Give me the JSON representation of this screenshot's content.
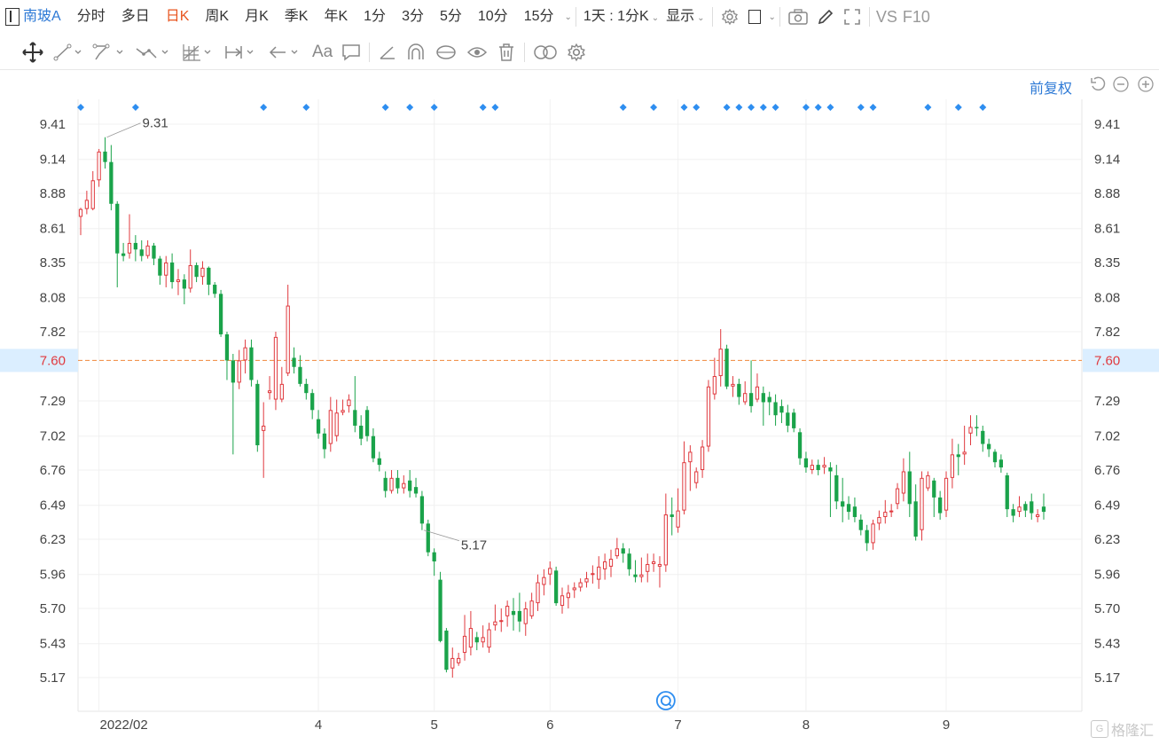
{
  "toolbar": {
    "stock_name": "南玻A",
    "periods": [
      "分时",
      "多日",
      "日K",
      "周K",
      "月K",
      "季K",
      "年K",
      "1分",
      "3分",
      "5分",
      "10分",
      "15分"
    ],
    "active_period": "日K",
    "interval_label": "1天 : 1分K",
    "display_label": "显示",
    "vs_label": "VS",
    "f10_label": "F10"
  },
  "drawing_tools": [
    "move-icon",
    "line-icon",
    "polyline-icon",
    "wave-icon",
    "grid-tool-icon",
    "measure-icon",
    "arrow-icon",
    "text-icon",
    "comment-icon",
    "angle-icon",
    "arch-icon",
    "cycle-icon",
    "eye-icon",
    "trash-icon",
    "link-icon",
    "settings-icon"
  ],
  "text_tool_label": "Aa",
  "adjust_label": "前复权",
  "watermark": "格隆汇",
  "colors": {
    "up": "#e0393e",
    "down": "#1aa34a",
    "accent": "#2e7ad6",
    "active": "#e8541e",
    "ref_line": "#f0883a"
  },
  "chart_data": {
    "type": "candlestick",
    "y_ticks": [
      "9.41",
      "9.14",
      "8.88",
      "8.61",
      "8.35",
      "8.08",
      "7.82",
      "7.29",
      "7.02",
      "6.76",
      "6.49",
      "6.23",
      "5.96",
      "5.70",
      "5.43",
      "5.17"
    ],
    "ylim": [
      5.06,
      9.58
    ],
    "x_tick_labels": [
      {
        "label": "2022/02",
        "index": 3
      },
      {
        "label": "4",
        "index": 39
      },
      {
        "label": "5",
        "index": 58
      },
      {
        "label": "6",
        "index": 77
      },
      {
        "label": "7",
        "index": 98
      },
      {
        "label": "8",
        "index": 119
      },
      {
        "label": "9",
        "index": 142
      }
    ],
    "current_price_label": "7.60",
    "current_price": 7.6,
    "high_label": "9.31",
    "high_index": 4,
    "low_label": "5.17",
    "low_index": 56,
    "event_marker_indices": [
      0,
      9,
      30,
      37,
      50,
      54,
      58,
      66,
      68,
      89,
      94,
      99,
      101,
      106,
      108,
      110,
      112,
      114,
      119,
      121,
      123,
      128,
      130,
      139,
      144,
      148
    ],
    "candles": [
      [
        8.7,
        8.76,
        8.56,
        8.77
      ],
      [
        8.76,
        8.83,
        8.72,
        8.9
      ],
      [
        8.76,
        8.98,
        8.75,
        9.05
      ],
      [
        8.98,
        9.2,
        8.93,
        9.22
      ],
      [
        9.2,
        9.12,
        9.07,
        9.31
      ],
      [
        9.12,
        8.8,
        8.75,
        9.25
      ],
      [
        8.8,
        8.42,
        8.16,
        8.82
      ],
      [
        8.42,
        8.4,
        8.36,
        8.5
      ],
      [
        8.42,
        8.5,
        8.38,
        8.72
      ],
      [
        8.5,
        8.45,
        8.36,
        8.56
      ],
      [
        8.45,
        8.4,
        8.36,
        8.52
      ],
      [
        8.4,
        8.48,
        8.38,
        8.52
      ],
      [
        8.48,
        8.38,
        8.33,
        8.5
      ],
      [
        8.38,
        8.25,
        8.18,
        8.4
      ],
      [
        8.25,
        8.35,
        8.16,
        8.4
      ],
      [
        8.35,
        8.2,
        8.15,
        8.42
      ],
      [
        8.2,
        8.22,
        8.1,
        8.3
      ],
      [
        8.22,
        8.15,
        8.03,
        8.26
      ],
      [
        8.15,
        8.33,
        8.12,
        8.45
      ],
      [
        8.33,
        8.24,
        8.2,
        8.35
      ],
      [
        8.24,
        8.31,
        8.18,
        8.36
      ],
      [
        8.31,
        8.18,
        8.1,
        8.32
      ],
      [
        8.18,
        8.11,
        8.08,
        8.2
      ],
      [
        8.11,
        7.8,
        7.78,
        8.14
      ],
      [
        7.8,
        7.6,
        7.45,
        7.82
      ],
      [
        7.6,
        7.43,
        6.88,
        7.65
      ],
      [
        7.43,
        7.6,
        7.38,
        7.68
      ],
      [
        7.6,
        7.7,
        7.5,
        7.76
      ],
      [
        7.7,
        7.45,
        7.4,
        7.76
      ],
      [
        7.42,
        6.95,
        6.9,
        7.45
      ],
      [
        7.06,
        7.1,
        6.7,
        7.28
      ],
      [
        7.35,
        7.37,
        7.3,
        7.48
      ],
      [
        7.3,
        7.78,
        7.22,
        7.82
      ],
      [
        7.3,
        7.42,
        7.28,
        7.55
      ],
      [
        7.5,
        8.02,
        7.48,
        8.18
      ],
      [
        7.62,
        7.55,
        7.5,
        7.7
      ],
      [
        7.55,
        7.42,
        7.4,
        7.64
      ],
      [
        7.42,
        7.35,
        7.3,
        7.46
      ],
      [
        7.35,
        7.22,
        7.15,
        7.38
      ],
      [
        7.15,
        7.04,
        7.0,
        7.22
      ],
      [
        7.04,
        6.92,
        6.85,
        7.08
      ],
      [
        6.96,
        7.22,
        6.9,
        7.32
      ],
      [
        7.02,
        7.2,
        6.98,
        7.3
      ],
      [
        7.2,
        7.22,
        7.18,
        7.3
      ],
      [
        7.25,
        7.3,
        7.2,
        7.34
      ],
      [
        7.22,
        7.1,
        7.05,
        7.48
      ],
      [
        7.1,
        7.0,
        6.95,
        7.18
      ],
      [
        7.22,
        7.02,
        6.98,
        7.25
      ],
      [
        7.02,
        6.85,
        6.82,
        7.08
      ],
      [
        6.85,
        6.8,
        6.75,
        6.9
      ],
      [
        6.7,
        6.6,
        6.55,
        6.75
      ],
      [
        6.6,
        6.7,
        6.58,
        6.76
      ],
      [
        6.7,
        6.62,
        6.58,
        6.76
      ],
      [
        6.62,
        6.66,
        6.58,
        6.72
      ],
      [
        6.68,
        6.6,
        6.55,
        6.76
      ],
      [
        6.63,
        6.58,
        6.55,
        6.7
      ],
      [
        6.56,
        6.35,
        6.3,
        6.6
      ],
      [
        6.35,
        6.13,
        6.1,
        6.38
      ],
      [
        6.13,
        6.06,
        5.95,
        6.16
      ],
      [
        5.92,
        5.45,
        5.44,
        5.98
      ],
      [
        5.53,
        5.23,
        5.21,
        5.55
      ],
      [
        5.24,
        5.32,
        5.17,
        5.4
      ],
      [
        5.28,
        5.32,
        5.26,
        5.36
      ],
      [
        5.36,
        5.49,
        5.3,
        5.65
      ],
      [
        5.4,
        5.55,
        5.34,
        5.68
      ],
      [
        5.48,
        5.44,
        5.38,
        5.52
      ],
      [
        5.44,
        5.48,
        5.4,
        5.57
      ],
      [
        5.4,
        5.54,
        5.36,
        5.59
      ],
      [
        5.57,
        5.6,
        5.53,
        5.73
      ],
      [
        5.6,
        5.61,
        5.52,
        5.7
      ],
      [
        5.64,
        5.72,
        5.56,
        5.76
      ],
      [
        5.68,
        5.65,
        5.53,
        5.78
      ],
      [
        5.68,
        5.6,
        5.52,
        5.82
      ],
      [
        5.58,
        5.7,
        5.49,
        5.75
      ],
      [
        5.64,
        5.76,
        5.62,
        5.82
      ],
      [
        5.74,
        5.9,
        5.68,
        5.96
      ],
      [
        5.88,
        5.94,
        5.8,
        6.0
      ],
      [
        5.96,
        6.01,
        5.88,
        6.06
      ],
      [
        5.99,
        5.74,
        5.72,
        6.02
      ],
      [
        5.72,
        5.8,
        5.66,
        5.86
      ],
      [
        5.78,
        5.82,
        5.7,
        5.88
      ],
      [
        5.84,
        5.86,
        5.78,
        5.9
      ],
      [
        5.86,
        5.9,
        5.83,
        5.93
      ],
      [
        5.9,
        5.93,
        5.86,
        5.98
      ],
      [
        5.96,
        5.97,
        5.89,
        6.03
      ],
      [
        5.92,
        6.02,
        5.85,
        6.1
      ],
      [
        6.0,
        6.06,
        5.92,
        6.12
      ],
      [
        6.02,
        6.08,
        5.94,
        6.15
      ],
      [
        6.1,
        6.16,
        6.08,
        6.24
      ],
      [
        6.16,
        6.12,
        6.05,
        6.2
      ],
      [
        6.12,
        6.0,
        5.95,
        6.16
      ],
      [
        5.96,
        5.94,
        5.9,
        6.07
      ],
      [
        5.94,
        5.96,
        5.9,
        6.09
      ],
      [
        5.98,
        6.04,
        5.9,
        6.12
      ],
      [
        6.04,
        6.06,
        5.98,
        6.12
      ],
      [
        6.02,
        6.04,
        5.86,
        6.1
      ],
      [
        6.03,
        6.42,
        5.98,
        6.58
      ],
      [
        6.42,
        6.4,
        6.26,
        6.55
      ],
      [
        6.32,
        6.45,
        6.28,
        6.62
      ],
      [
        6.45,
        6.82,
        6.42,
        6.98
      ],
      [
        6.82,
        6.9,
        6.6,
        6.95
      ],
      [
        6.66,
        6.75,
        6.62,
        6.78
      ],
      [
        6.76,
        6.94,
        6.7,
        6.99
      ],
      [
        6.94,
        7.4,
        6.9,
        7.45
      ],
      [
        7.34,
        7.48,
        7.3,
        7.62
      ],
      [
        7.48,
        7.69,
        7.4,
        7.84
      ],
      [
        7.69,
        7.4,
        7.38,
        7.72
      ],
      [
        7.4,
        7.42,
        7.32,
        7.48
      ],
      [
        7.42,
        7.32,
        7.26,
        7.46
      ],
      [
        7.28,
        7.35,
        7.26,
        7.44
      ],
      [
        7.35,
        7.25,
        7.2,
        7.6
      ],
      [
        7.3,
        7.4,
        7.28,
        7.5
      ],
      [
        7.35,
        7.28,
        7.1,
        7.4
      ],
      [
        7.32,
        7.28,
        7.18,
        7.36
      ],
      [
        7.28,
        7.18,
        7.1,
        7.34
      ],
      [
        7.25,
        7.2,
        7.12,
        7.3
      ],
      [
        7.2,
        7.1,
        7.05,
        7.26
      ],
      [
        7.2,
        7.08,
        7.05,
        7.23
      ],
      [
        7.05,
        6.85,
        6.8,
        7.08
      ],
      [
        6.85,
        6.78,
        6.74,
        6.9
      ],
      [
        6.76,
        6.8,
        6.73,
        6.84
      ],
      [
        6.8,
        6.76,
        6.72,
        6.84
      ],
      [
        6.78,
        6.8,
        6.73,
        6.86
      ],
      [
        6.78,
        6.75,
        6.4,
        6.82
      ],
      [
        6.72,
        6.52,
        6.46,
        6.8
      ],
      [
        6.52,
        6.48,
        6.36,
        6.7
      ],
      [
        6.5,
        6.44,
        6.38,
        6.56
      ],
      [
        6.48,
        6.4,
        6.36,
        6.55
      ],
      [
        6.38,
        6.3,
        6.26,
        6.42
      ],
      [
        6.3,
        6.2,
        6.14,
        6.34
      ],
      [
        6.2,
        6.35,
        6.15,
        6.38
      ],
      [
        6.35,
        6.4,
        6.3,
        6.45
      ],
      [
        6.4,
        6.44,
        6.35,
        6.53
      ],
      [
        6.44,
        6.45,
        6.4,
        6.5
      ],
      [
        6.5,
        6.62,
        6.46,
        6.66
      ],
      [
        6.58,
        6.75,
        6.52,
        6.85
      ],
      [
        6.75,
        6.5,
        6.4,
        6.9
      ],
      [
        6.52,
        6.25,
        6.22,
        6.65
      ],
      [
        6.3,
        6.7,
        6.22,
        6.75
      ],
      [
        6.62,
        6.72,
        6.6,
        6.75
      ],
      [
        6.68,
        6.55,
        6.4,
        6.7
      ],
      [
        6.55,
        6.43,
        6.38,
        6.6
      ],
      [
        6.45,
        6.7,
        6.4,
        6.75
      ],
      [
        6.7,
        6.88,
        6.62,
        7.0
      ],
      [
        6.88,
        6.86,
        6.72,
        6.96
      ],
      [
        6.88,
        6.9,
        6.8,
        7.1
      ],
      [
        7.04,
        7.09,
        6.95,
        7.18
      ],
      [
        7.09,
        7.08,
        7.02,
        7.18
      ],
      [
        7.06,
        6.96,
        6.9,
        7.1
      ],
      [
        6.96,
        6.92,
        6.86,
        7.0
      ],
      [
        6.9,
        6.82,
        6.78,
        6.92
      ],
      [
        6.84,
        6.78,
        6.74,
        6.88
      ],
      [
        6.72,
        6.46,
        6.4,
        6.74
      ],
      [
        6.46,
        6.41,
        6.36,
        6.5
      ],
      [
        6.44,
        6.48,
        6.4,
        6.56
      ],
      [
        6.5,
        6.45,
        6.4,
        6.52
      ],
      [
        6.52,
        6.43,
        6.38,
        6.58
      ],
      [
        6.4,
        6.42,
        6.36,
        6.46
      ],
      [
        6.48,
        6.44,
        6.38,
        6.58
      ]
    ]
  }
}
